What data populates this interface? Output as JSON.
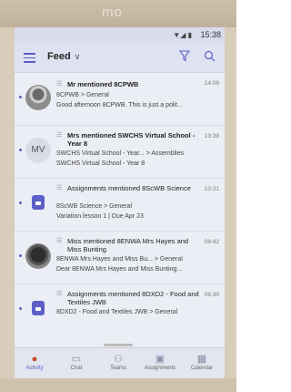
{
  "device": {
    "brand": "mo"
  },
  "status": {
    "time": "15:38",
    "icons": "▼◢ ▮"
  },
  "header": {
    "title": "Feed",
    "chevron": "∨"
  },
  "feed": [
    {
      "title": "Mr mentioned 8CPWB",
      "time": "14:06",
      "line1": "8CPWB > General",
      "line2": "Good afternoon 8CPWB. This is just a polit..."
    },
    {
      "title": "Mrs mentioned SWCHS Virtual School - Year 8",
      "time": "13:39",
      "avatar_text": "MV",
      "line1": "SWCHS Virtual School - Year... > Assemblies",
      "line2": "SWCHS Virtual School - Year 8"
    },
    {
      "title": "Assignments mentioned 8ScWB Science",
      "time": "10:31",
      "line1": "8ScWB Science > General",
      "line2": "Variation lesson 1 | Due Apr 23"
    },
    {
      "title": "Miss mentioned 8ENWA Mrs Hayes and Miss Bunting",
      "time": "08:42",
      "line1": "8ENWA Mrs Hayes and Miss Bu... > General",
      "line2": "Dear 8ENWA Mrs Hayes and Miss Bunting..."
    },
    {
      "title": "Assignments mentioned 8DXD2 - Food and Textiles JWB",
      "time": "08:30",
      "line1": "8DXD2 - Food and Textiles JWB > General",
      "line2": ""
    }
  ],
  "nav": [
    {
      "label": "Activity",
      "icon": "bell-icon"
    },
    {
      "label": "Chat",
      "icon": "chat-icon"
    },
    {
      "label": "Teams",
      "icon": "teams-icon"
    },
    {
      "label": "Assignments",
      "icon": "assignments-icon"
    },
    {
      "label": "Calendar",
      "icon": "calendar-icon"
    }
  ],
  "colors": {
    "accent": "#5b5fc7",
    "active_icon": "#c44a2f",
    "background": "#eceef5"
  }
}
